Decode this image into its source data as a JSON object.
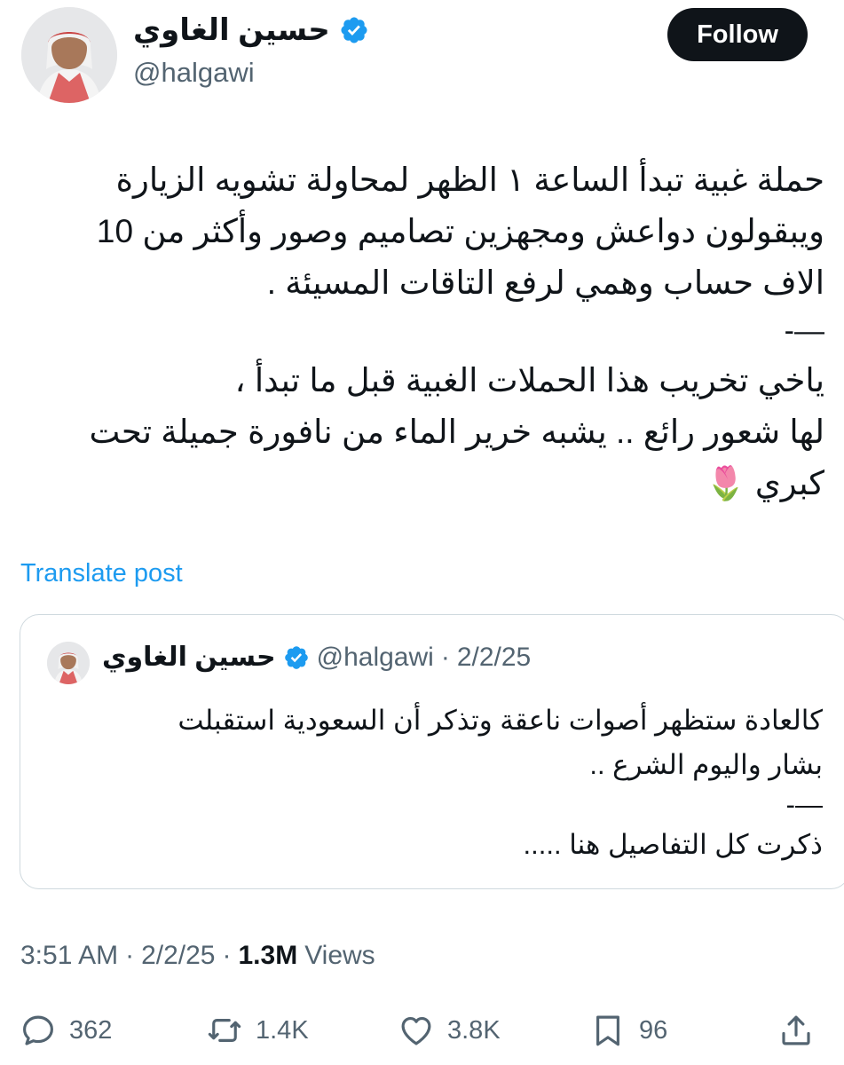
{
  "author": {
    "display_name": "حسين الغاوي",
    "handle": "@halgawi",
    "verified": true
  },
  "follow_label": "Follow",
  "tweet": {
    "lines": [
      "حملة غبية تبدأ الساعة ١ الظهر لمحاولة تشويه الزيارة",
      "ويبقولون دواعش ومجهزين تصاميم وصور وأكثر من 10",
      "الاف حساب وهمي لرفع التاقات المسيئة .",
      "—-",
      "ياخي تخريب هذا الحملات الغبية قبل ما تبدأ ،",
      "لها شعور رائع .. يشبه خرير الماء من نافورة جميلة تحت",
      "كبري 🌷"
    ]
  },
  "translate_label": "Translate post",
  "quote": {
    "display_name": "حسين الغاوي",
    "handle": "@halgawi",
    "separator": "·",
    "date": "2/2/25",
    "lines": [
      "كالعادة ستظهر أصوات ناعقة وتذكر أن السعودية استقبلت",
      "بشار واليوم الشرع ..",
      "—-",
      "ذكرت كل التفاصيل هنا ....."
    ]
  },
  "meta": {
    "time": "3:51 AM",
    "sep1": "·",
    "date": "2/2/25",
    "sep2": "·",
    "views_count": "1.3M",
    "views_label": "Views"
  },
  "actions": {
    "replies": "362",
    "reposts": "1.4K",
    "likes": "3.8K",
    "bookmarks": "96"
  },
  "colors": {
    "accent": "#1d9bf0",
    "text": "#0f1419",
    "muted": "#536471",
    "border": "#cfd9de"
  },
  "icons": [
    "verified-badge-icon",
    "reply-icon",
    "repost-icon",
    "like-icon",
    "bookmark-icon",
    "share-icon"
  ]
}
